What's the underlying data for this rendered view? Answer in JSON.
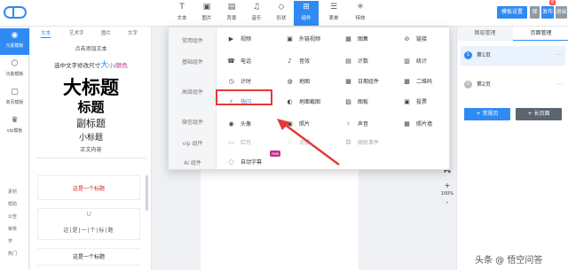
{
  "toolbar": {
    "tools": [
      "文本",
      "图片",
      "背景",
      "音乐",
      "形状",
      "组件",
      "表单",
      "特效"
    ],
    "active_tool": "组件",
    "right_buttons": [
      "模板设置",
      "保存",
      "发布",
      "退出"
    ],
    "badge": "6"
  },
  "rail": {
    "items": [
      "元素模板",
      "功能模板",
      "单页模板",
      "vip模板"
    ],
    "links": [
      "素材",
      "帮助",
      "公告",
      "审核",
      "学",
      "热门"
    ]
  },
  "panel": {
    "tabs": [
      "文本",
      "艺术字",
      "图片",
      "文字"
    ],
    "add_text": "点击添加文本",
    "hint_prefix": "选中文字修改尺寸",
    "hint_big": "大",
    "hint_small": "小",
    "hint_sep": "/",
    "hint_color": "颜色",
    "big_title": "大标题",
    "title": "标题",
    "subtitle": "副标题",
    "small_title": "小标题",
    "body": "正文内容",
    "card1": "这是一个标题",
    "card2_icon": "∪",
    "card2": "这|是|一|个|标|题",
    "card3": "这是一个标题"
  },
  "dropdown": {
    "categories": [
      "常用组件",
      "基础组件",
      "高级组件",
      "微信组件",
      "vip 组件",
      "AI 组件"
    ],
    "components": {
      "r1": [
        "视频",
        "外链视频",
        "图集",
        "链接"
      ],
      "r2": [
        "电话",
        "音效",
        "计数",
        "统计"
      ],
      "r3": [
        "计时",
        "地图",
        "日期组件",
        "二维码"
      ],
      "r4": [
        "快闪",
        "地面截图",
        "图板",
        "投票"
      ],
      "r5": [
        "头像",
        "照片",
        "声音",
        "照片墙"
      ],
      "r6": [
        "红包",
        "点赞",
        "随机事件"
      ],
      "r7": [
        "自动字幕"
      ]
    },
    "highlighted": "快闪",
    "new_badge": "new"
  },
  "canvas": {
    "tool_labels": [
      "Ps",
      "+",
      "100%",
      "-"
    ]
  },
  "right_panel": {
    "tabs": [
      "图层管理",
      "页面管理"
    ],
    "active_tab": "页面管理",
    "pages": [
      {
        "num": "1",
        "label": "第1页"
      },
      {
        "num": "2",
        "label": "第2页"
      }
    ],
    "btn_normal": "+ 常规页",
    "btn_long": "+ 长页面"
  },
  "watermark": "头条 @ 悟空问答",
  "colors": {
    "primary": "#2f8bf3",
    "highlight": "#e53935",
    "magenta": "#c12d8c"
  },
  "icons": [
    "logo",
    "text-icon",
    "image-icon",
    "background-icon",
    "music-icon",
    "shape-icon",
    "components-icon",
    "form-icon",
    "effects-icon",
    "arrow-annotation"
  ]
}
